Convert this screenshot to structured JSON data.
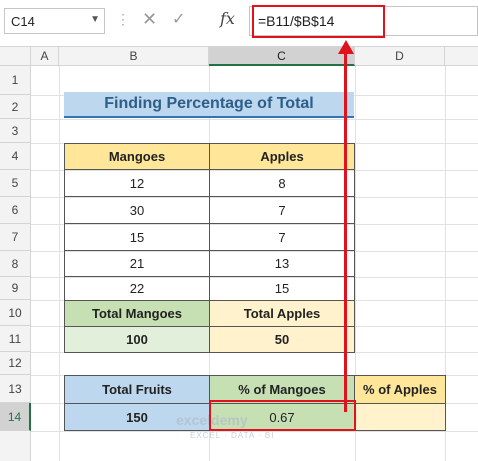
{
  "formula_bar": {
    "name_box": "C14",
    "formula": "=B11/$B$14",
    "fx_label": "fx",
    "cancel_glyph": "✕",
    "enter_glyph": "✓",
    "dots_glyph": "⋮"
  },
  "columns": [
    "A",
    "B",
    "C",
    "D"
  ],
  "rows": [
    "1",
    "2",
    "3",
    "4",
    "5",
    "6",
    "7",
    "8",
    "9",
    "10",
    "11",
    "12",
    "13",
    "14"
  ],
  "sheet": {
    "title": "Finding Percentage of Total",
    "table1": {
      "headers": [
        "Mangoes",
        "Apples"
      ],
      "rows": [
        [
          "12",
          "8"
        ],
        [
          "30",
          "7"
        ],
        [
          "15",
          "7"
        ],
        [
          "21",
          "13"
        ],
        [
          "22",
          "15"
        ]
      ]
    },
    "totals": {
      "headers": [
        "Total Mangoes",
        "Total Apples"
      ],
      "values": [
        "100",
        "50"
      ]
    },
    "table2": {
      "headers": [
        "Total Fruits",
        "% of Mangoes",
        "% of Apples"
      ],
      "values": [
        "150",
        "0.67",
        ""
      ]
    }
  },
  "watermark": {
    "brand": "exceldemy",
    "tagline": "EXCEL · DATA · BI"
  },
  "colors": {
    "title_bg": "#bdd7ee",
    "title_text": "#2e5f8a",
    "yellow": "#ffe699",
    "light_yellow": "#fff2cc",
    "green": "#c6e0b4",
    "light_green": "#e2efda",
    "blue": "#bdd7ee",
    "highlight_red": "#e0121b"
  }
}
